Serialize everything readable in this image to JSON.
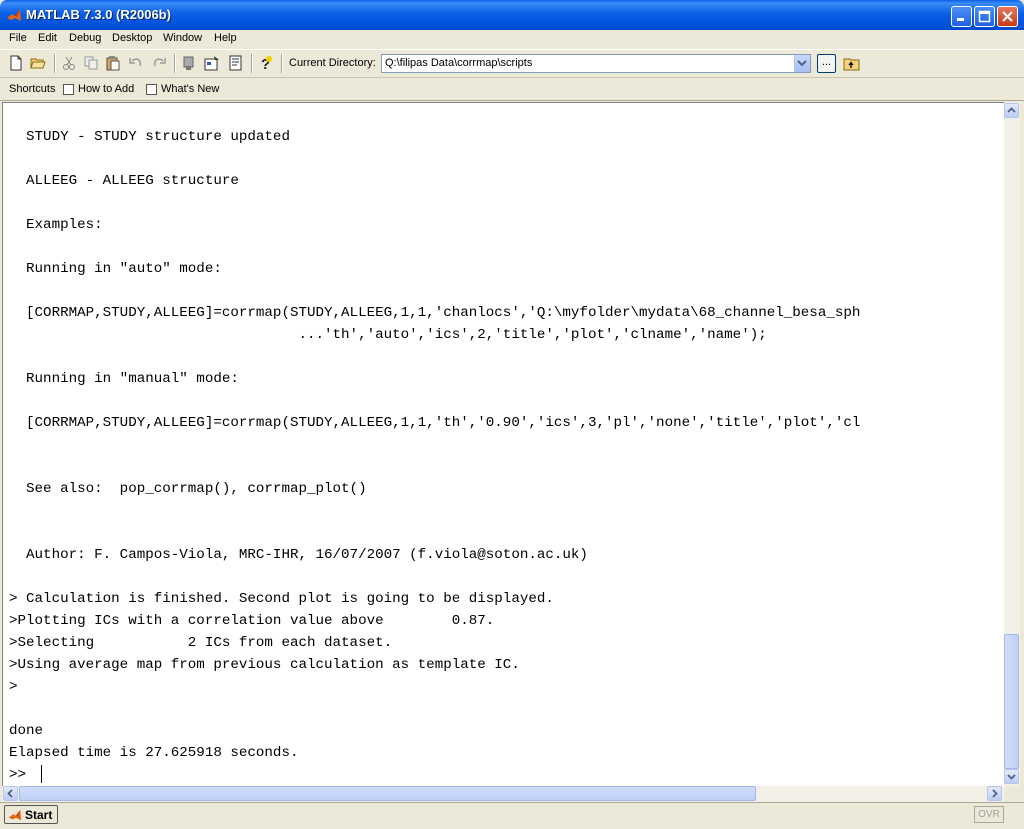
{
  "window": {
    "title": "MATLAB  7.3.0 (R2006b)"
  },
  "menu": [
    "File",
    "Edit",
    "Debug",
    "Desktop",
    "Window",
    "Help"
  ],
  "toolbar": {
    "current_directory_label": "Current Directory:",
    "current_directory_value": "Q:\\filipas Data\\corrmap\\scripts",
    "browse_label": "..."
  },
  "shortcuts": {
    "label": "Shortcuts",
    "how_to_add": "How to Add",
    "whats_new": "What's New"
  },
  "command_window": {
    "lines": [
      "  STUDY - STUDY structure updated",
      "",
      "  ALLEEG - ALLEEG structure",
      "",
      "  Examples:",
      "",
      "  Running in \"auto\" mode:",
      "",
      "  [CORRMAP,STUDY,ALLEEG]=corrmap(STUDY,ALLEEG,1,1,'chanlocs','Q:\\myfolder\\mydata\\68_channel_besa_sph",
      "                                  ...'th','auto','ics',2,'title','plot','clname','name');",
      "",
      "  Running in \"manual\" mode:",
      "",
      "  [CORRMAP,STUDY,ALLEEG]=corrmap(STUDY,ALLEEG,1,1,'th','0.90','ics',3,'pl','none','title','plot','cl",
      "",
      "",
      "  See also:  pop_corrmap(), corrmap_plot()",
      "",
      "",
      "  Author: F. Campos-Viola, MRC-IHR, 16/07/2007 (f.viola@soton.ac.uk)",
      "",
      "> Calculation is finished. Second plot is going to be displayed.",
      ">Plotting ICs with a correlation value above        0.87.",
      ">Selecting           2 ICs from each dataset.",
      ">Using average map from previous calculation as template IC.",
      ">",
      "",
      "done",
      "Elapsed time is 27.625918 seconds.",
      ">> "
    ]
  },
  "statusbar": {
    "start_label": "Start",
    "ovr_label": "OVR"
  },
  "colors": {
    "titlebar": "#0a5fe6",
    "chrome": "#ece9d8",
    "command_bg": "#ffffff"
  }
}
